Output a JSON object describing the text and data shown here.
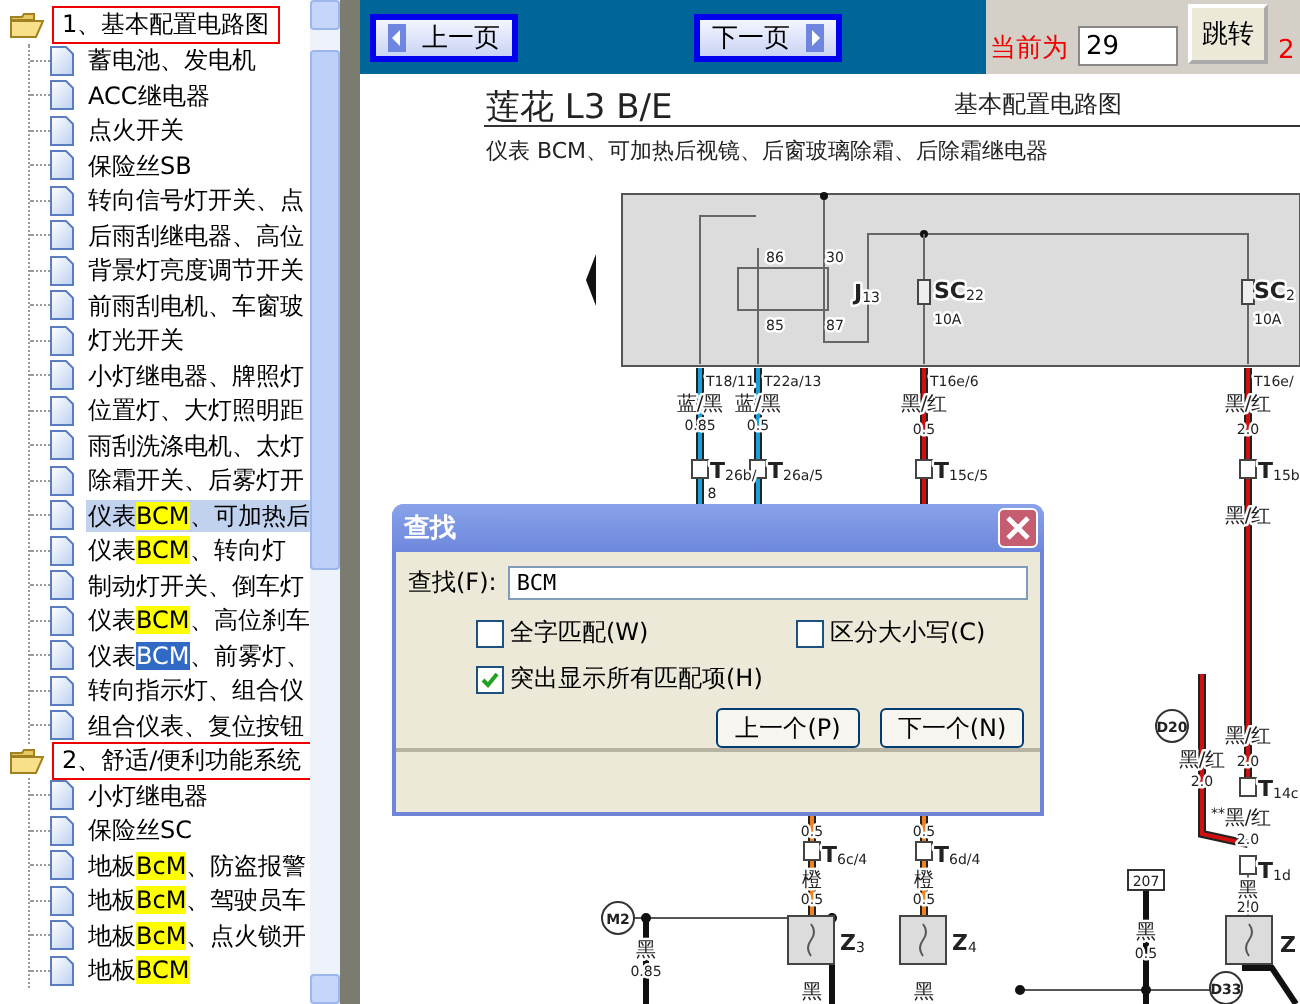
{
  "tree": [
    {
      "label": "1、基本配置电路图",
      "expanded": true,
      "boxed": true,
      "children": [
        {
          "parts": [
            {
              "text": "蓄电池、发电机",
              "kind": "plain"
            }
          ],
          "selected": false
        },
        {
          "parts": [
            {
              "text": "ACC继电器",
              "kind": "plain"
            }
          ],
          "selected": false
        },
        {
          "parts": [
            {
              "text": "点火开关",
              "kind": "plain"
            }
          ],
          "selected": false
        },
        {
          "parts": [
            {
              "text": "保险丝SB",
              "kind": "plain"
            }
          ],
          "selected": false
        },
        {
          "parts": [
            {
              "text": "转向信号灯开关、点",
              "kind": "plain"
            }
          ],
          "selected": false
        },
        {
          "parts": [
            {
              "text": "后雨刮继电器、高位",
              "kind": "plain"
            }
          ],
          "selected": false
        },
        {
          "parts": [
            {
              "text": "背景灯亮度调节开关",
              "kind": "plain"
            }
          ],
          "selected": false
        },
        {
          "parts": [
            {
              "text": "前雨刮电机、车窗玻",
              "kind": "plain"
            }
          ],
          "selected": false
        },
        {
          "parts": [
            {
              "text": "灯光开关",
              "kind": "plain"
            }
          ],
          "selected": false
        },
        {
          "parts": [
            {
              "text": "小灯继电器、牌照灯",
              "kind": "plain"
            }
          ],
          "selected": false
        },
        {
          "parts": [
            {
              "text": "位置灯、大灯照明距",
              "kind": "plain"
            }
          ],
          "selected": false
        },
        {
          "parts": [
            {
              "text": "雨刮洗涤电机、太灯",
              "kind": "plain"
            }
          ],
          "selected": false
        },
        {
          "parts": [
            {
              "text": "除霜开关、后雾灯开",
              "kind": "plain"
            }
          ],
          "selected": false
        },
        {
          "parts": [
            {
              "text": "仪表",
              "kind": "plain"
            },
            {
              "text": "BCM",
              "kind": "match"
            },
            {
              "text": "、可加热后",
              "kind": "plain"
            }
          ],
          "selected": true
        },
        {
          "parts": [
            {
              "text": "仪表",
              "kind": "plain"
            },
            {
              "text": "BCM",
              "kind": "match"
            },
            {
              "text": "、转向灯",
              "kind": "plain"
            }
          ],
          "selected": false
        },
        {
          "parts": [
            {
              "text": "制动灯开关、倒车灯",
              "kind": "plain"
            }
          ],
          "selected": false
        },
        {
          "parts": [
            {
              "text": "仪表",
              "kind": "plain"
            },
            {
              "text": "BCM",
              "kind": "match"
            },
            {
              "text": "、高位刹车",
              "kind": "plain"
            }
          ],
          "selected": false
        },
        {
          "parts": [
            {
              "text": "仪表",
              "kind": "plain"
            },
            {
              "text": "BCM",
              "kind": "current"
            },
            {
              "text": "、前雾灯、",
              "kind": "plain"
            }
          ],
          "selected": false
        },
        {
          "parts": [
            {
              "text": "转向指示灯、组合仪",
              "kind": "plain"
            }
          ],
          "selected": false
        },
        {
          "parts": [
            {
              "text": "组合仪表、复位按钮",
              "kind": "plain"
            }
          ],
          "selected": false
        }
      ]
    },
    {
      "label": "2、舒适/便利功能系统",
      "expanded": true,
      "boxed": true,
      "children": [
        {
          "parts": [
            {
              "text": "小灯继电器",
              "kind": "plain"
            }
          ],
          "selected": false
        },
        {
          "parts": [
            {
              "text": "保险丝SC",
              "kind": "plain"
            }
          ],
          "selected": false
        },
        {
          "parts": [
            {
              "text": "地板",
              "kind": "plain"
            },
            {
              "text": "BcM",
              "kind": "match"
            },
            {
              "text": "、防盗报警",
              "kind": "plain"
            }
          ],
          "selected": false
        },
        {
          "parts": [
            {
              "text": "地板",
              "kind": "plain"
            },
            {
              "text": "BcM",
              "kind": "match"
            },
            {
              "text": "、驾驶员车",
              "kind": "plain"
            }
          ],
          "selected": false
        },
        {
          "parts": [
            {
              "text": "地板",
              "kind": "plain"
            },
            {
              "text": "BcM",
              "kind": "match"
            },
            {
              "text": "、点火锁开",
              "kind": "plain"
            }
          ],
          "selected": false
        },
        {
          "parts": [
            {
              "text": "地板",
              "kind": "plain"
            },
            {
              "text": "BCM",
              "kind": "match"
            }
          ],
          "selected": false
        }
      ]
    }
  ],
  "toolbar": {
    "prev_button": "上一页",
    "next_button": "下一页",
    "page_label": "当前为",
    "page_value": "29",
    "go_button": "跳转",
    "trailing": "2"
  },
  "document": {
    "title": "莲花 L3 B/E",
    "section": "基本配置电路图",
    "subtitle": "仪表 BCM、可加热后视镜、后窗玻璃除霜、后除霜继电器",
    "labels": [
      {
        "text": "86"
      },
      {
        "text": "30"
      },
      {
        "text": "85"
      },
      {
        "text": "87"
      },
      {
        "text": "J",
        "sub": "13"
      },
      {
        "text": "SC",
        "sub": "22"
      },
      {
        "text": "10A"
      },
      {
        "text": "SC",
        "sub": "2"
      },
      {
        "text": "10A"
      },
      {
        "text": "T18/11"
      },
      {
        "text": "T22a/13"
      },
      {
        "text": "T16e/6"
      },
      {
        "text": "T16e/"
      },
      {
        "text": "蓝/黑"
      },
      {
        "text": "0.85"
      },
      {
        "text": "蓝/黑"
      },
      {
        "text": "0.5"
      },
      {
        "text": "黑/红"
      },
      {
        "text": "0.5"
      },
      {
        "text": "黑/红"
      },
      {
        "text": "2.0"
      },
      {
        "text": "T",
        "sub": "26b/"
      },
      {
        "text": "8"
      },
      {
        "text": "T",
        "sub": "26a/5"
      },
      {
        "text": "T",
        "sub": "15c/5"
      },
      {
        "text": "T",
        "sub": "15b"
      },
      {
        "text": "黑/红"
      },
      {
        "text": "D20"
      },
      {
        "text": "黑/红"
      },
      {
        "text": "2.0"
      },
      {
        "text": "**"
      },
      {
        "text": "黑/红"
      },
      {
        "text": "2.0"
      },
      {
        "text": "T",
        "sub": "14c"
      },
      {
        "text": "黑/红"
      },
      {
        "text": "2.0"
      },
      {
        "text": "T",
        "sub": "1d"
      },
      {
        "text": "黑"
      },
      {
        "text": "2.0"
      },
      {
        "text": "Z"
      },
      {
        "text": "207"
      },
      {
        "text": "黑"
      },
      {
        "text": "0.5"
      },
      {
        "text": "D33"
      },
      {
        "text": "M2"
      },
      {
        "text": "黑"
      },
      {
        "text": "0.85"
      },
      {
        "text": "0.5"
      },
      {
        "text": "T",
        "sub": "6c/4"
      },
      {
        "text": "橙"
      },
      {
        "text": "0.5"
      },
      {
        "text": "Z",
        "sub": "3"
      },
      {
        "text": "黑"
      },
      {
        "text": "0.5"
      },
      {
        "text": "T",
        "sub": "6d/4"
      },
      {
        "text": "橙"
      },
      {
        "text": "0.5"
      },
      {
        "text": "Z",
        "sub": "4"
      },
      {
        "text": "黑"
      }
    ]
  },
  "dialog": {
    "title": "查找",
    "find_label": "查找(F):",
    "find_value": "BCM",
    "options": [
      {
        "label": "全字匹配(W)",
        "checked": false
      },
      {
        "label": "区分大小写(C)",
        "checked": false
      },
      {
        "label": "突出显示所有匹配项(H)",
        "checked": true
      }
    ],
    "buttons": [
      "上一个(P)",
      "下一个(N)"
    ]
  }
}
